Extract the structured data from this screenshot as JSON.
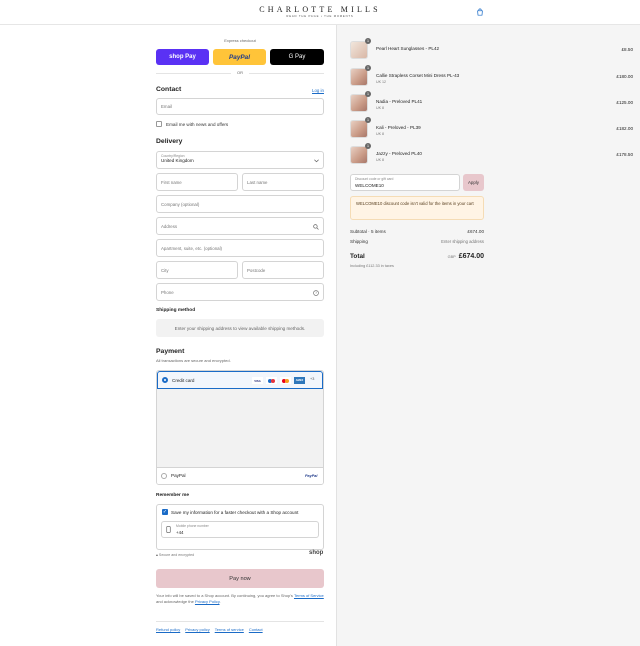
{
  "header": {
    "brand": "CHARLOTTE MILLS",
    "tagline": "READ THE PAGE • THE MOMENTS"
  },
  "express": {
    "title": "Express checkout",
    "shop_pay": "shop Pay",
    "paypal": "PayPal",
    "gpay": "G Pay",
    "or": "OR"
  },
  "contact": {
    "title": "Contact",
    "login": "Log in",
    "email_placeholder": "Email",
    "news_label": "Email me with news and offers"
  },
  "delivery": {
    "title": "Delivery",
    "country_label": "Country/Region",
    "country_value": "United Kingdom",
    "first_name": "First name",
    "last_name": "Last name",
    "company": "Company (optional)",
    "address": "Address",
    "apartment": "Apartment, suite, etc. (optional)",
    "city": "City",
    "postcode": "Postcode",
    "phone": "Phone"
  },
  "shipping_method": {
    "title": "Shipping method",
    "note": "Enter your shipping address to view available shipping methods."
  },
  "payment": {
    "title": "Payment",
    "subtitle": "All transactions are secure and encrypted.",
    "credit_card": "Credit card",
    "cards": [
      "VISA",
      "MC",
      "MAE",
      "AMEX"
    ],
    "more": "+3",
    "paypal": "PayPal",
    "paypal_logo": "PayPal"
  },
  "remember": {
    "title": "Remember me",
    "save_label": "Save my information for a faster checkout with a Shop account",
    "phone_label": "Mobile phone number",
    "phone_value": "+44",
    "secure": "Secure and encrypted",
    "shop": "shop"
  },
  "pay_now": "Pay now",
  "legal": {
    "line1": "Your info will be saved to a Shop account. By continuing, you agree to Shop's",
    "terms": "Terms of Service",
    "middle": "and acknowledge the",
    "privacy": "Privacy Policy",
    "end": "."
  },
  "footer": {
    "links": [
      "Refund policy",
      "Privacy policy",
      "Terms of service",
      "Contact"
    ]
  },
  "cart": {
    "items": [
      {
        "name": "Pearl Heart Sunglasses - PL42",
        "variant": "",
        "price": "£8.50",
        "qty": "1"
      },
      {
        "name": "Callie Strapless Corset Mini Dress PL-43",
        "variant": "UK 12",
        "price": "£180.00",
        "qty": "1"
      },
      {
        "name": "Nadia - Preloved PL41",
        "variant": "UK 8",
        "price": "£125.00",
        "qty": "1"
      },
      {
        "name": "Kali - Preloved - PL39",
        "variant": "UK 8",
        "price": "£182.00",
        "qty": "1"
      },
      {
        "name": "Jazzy - Preloved PL40",
        "variant": "UK 8",
        "price": "£178.50",
        "qty": "1"
      }
    ],
    "discount_label": "Discount code or gift card",
    "discount_value": "WELCOME10",
    "apply": "Apply",
    "warning": "WELCOME10 discount code isn't valid for the items in your cart",
    "subtotal_label": "Subtotal · 5 items",
    "subtotal": "£674.00",
    "shipping_label": "Shipping",
    "shipping_value": "Enter shipping address",
    "total_label": "Total",
    "currency": "GBP",
    "total": "£674.00",
    "tax_note": "Including £112.33 in taxes"
  },
  "colors": {
    "accent": "#1a6bc7",
    "shop_pay": "#5a31f4",
    "paypal": "#ffc439",
    "pay_btn": "#e8c7cc",
    "warning_bg": "#fff4e5"
  }
}
